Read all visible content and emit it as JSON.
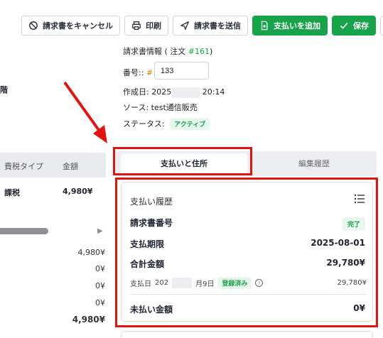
{
  "toolbar": {
    "cancel_label": "請求書をキャンセル",
    "print_label": "印刷",
    "send_label": "請求書を送信",
    "add_payment_label": "支払いを追加",
    "save_label": "保存",
    "more_label": "···"
  },
  "left_partial": {
    "floor_text": "階",
    "col_tax_type": "費税タイプ",
    "col_amount": "金額",
    "row_tax": "課税",
    "row_amount": "4,980¥",
    "totals": [
      "4,980¥",
      "0¥",
      "0¥",
      "0¥"
    ],
    "grand_total": "4,980¥"
  },
  "invoice_info": {
    "heading_prefix": "請求書情報 ( 注文 ",
    "order_number": "#161",
    "heading_suffix": ")",
    "number_label": "番号::",
    "hash": "#",
    "number_value": "133",
    "created_label": "作成日:",
    "created_year": "2025",
    "created_time": "20:14",
    "source_label": "ソース:",
    "source_value": "test通信販売",
    "status_label": "ステータス:",
    "status_value": "アクティブ"
  },
  "tabs": {
    "payment_address": "支払いと住所",
    "edit_history": "編集履歴"
  },
  "payment_card": {
    "title": "支払い履歴",
    "invoice_number_label": "請求書番号",
    "invoice_status": "完了",
    "due_label": "支払期限",
    "due_value": "2025-08-01",
    "total_label": "合計金額",
    "total_value": "29,780¥",
    "pay_date_label": "支払日",
    "pay_date_year": "202",
    "pay_date_day": "月9日",
    "registered_badge": "登録済み",
    "info_glyph": "!",
    "pay_amount": "29,780¥",
    "unpaid_label": "未払い金額",
    "unpaid_value": "0¥"
  },
  "colors": {
    "accent_green": "#16a34a",
    "annotation_red": "#e3140f"
  }
}
